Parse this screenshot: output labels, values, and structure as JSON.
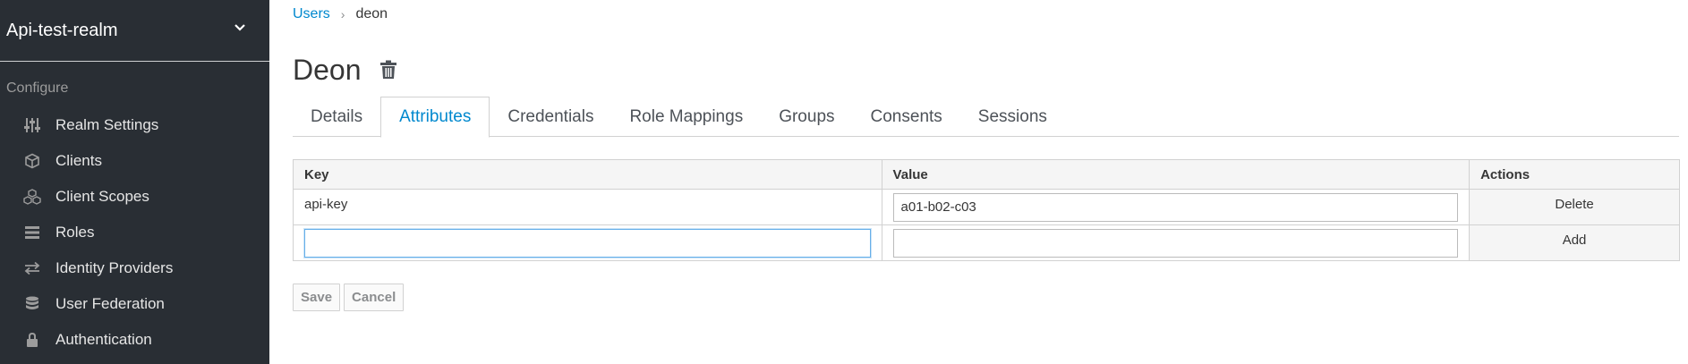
{
  "sidebar": {
    "realm_name": "Api-test-realm",
    "section_label": "Configure",
    "items": [
      {
        "label": "Realm Settings",
        "icon": "sliders-icon"
      },
      {
        "label": "Clients",
        "icon": "cube-icon"
      },
      {
        "label": "Client Scopes",
        "icon": "cubes-icon"
      },
      {
        "label": "Roles",
        "icon": "tasks-icon"
      },
      {
        "label": "Identity Providers",
        "icon": "exchange-icon"
      },
      {
        "label": "User Federation",
        "icon": "database-icon"
      },
      {
        "label": "Authentication",
        "icon": "lock-icon"
      }
    ]
  },
  "breadcrumb": {
    "parent": "Users",
    "current": "deon"
  },
  "page": {
    "title": "Deon"
  },
  "tabs": [
    {
      "label": "Details",
      "active": false
    },
    {
      "label": "Attributes",
      "active": true
    },
    {
      "label": "Credentials",
      "active": false
    },
    {
      "label": "Role Mappings",
      "active": false
    },
    {
      "label": "Groups",
      "active": false
    },
    {
      "label": "Consents",
      "active": false
    },
    {
      "label": "Sessions",
      "active": false
    }
  ],
  "table": {
    "headers": {
      "key": "Key",
      "value": "Value",
      "actions": "Actions"
    },
    "rows": [
      {
        "key": "api-key",
        "value": "a01-b02-c03",
        "action": "Delete"
      }
    ],
    "new_row": {
      "key": "",
      "value": "",
      "action": "Add"
    }
  },
  "buttons": {
    "save": "Save",
    "cancel": "Cancel"
  },
  "colors": {
    "sidebar_bg": "#292e34",
    "accent": "#0088ce"
  }
}
